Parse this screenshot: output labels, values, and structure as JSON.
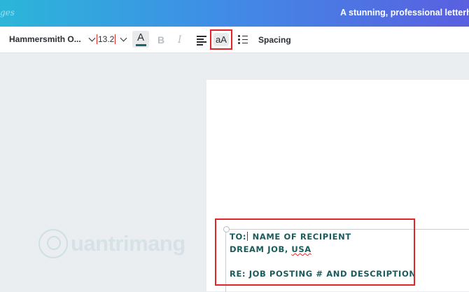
{
  "banner": {
    "breadcrumb_fragment": "ges",
    "title": "A stunning, professional letterhead is"
  },
  "toolbar": {
    "font_name": "Hammersmith O...",
    "font_size": "13.2",
    "text_color_letter": "A",
    "text_color": "#1b6666",
    "bold_label": "B",
    "italic_label": "I",
    "case_label": "aA",
    "spacing_label": "Spacing"
  },
  "document": {
    "lines": [
      {
        "before_caret": "TO:",
        "after_caret": " NAME OF RECIPIENT"
      },
      {
        "plain": "DREAM JOB, ",
        "misspelled": "USA"
      },
      {
        "blank": ""
      },
      {
        "plain": "RE: JOB POSTING # AND DESCRIPTION"
      }
    ]
  },
  "watermark": {
    "text": "uantrimang"
  },
  "colors": {
    "highlight": "#e0262b",
    "text": "#1b5b5b",
    "banner_start": "#2bb6d9",
    "banner_end": "#5a5fe0"
  }
}
